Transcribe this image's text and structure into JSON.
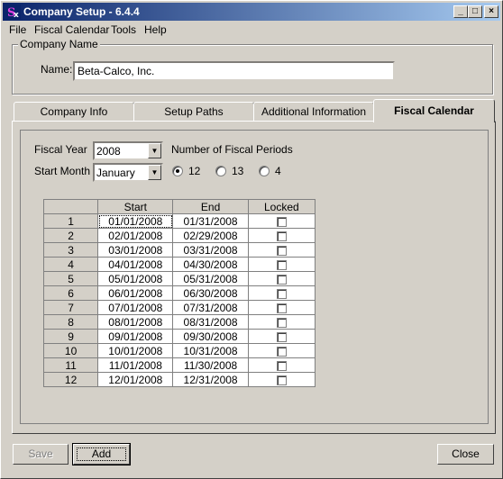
{
  "window": {
    "title": "Company Setup - 6.4.4",
    "controls": {
      "minimize": "_",
      "maximize": "□",
      "close": "×"
    }
  },
  "menu": [
    {
      "label": "File"
    },
    {
      "label": "Fiscal Calendar"
    },
    {
      "label": "Tools"
    },
    {
      "label": "Help"
    }
  ],
  "company": {
    "group_title": "Company Name",
    "name_label": "Name:",
    "name_value": "Beta-Calco, Inc."
  },
  "tabs": [
    {
      "label": "Company Info"
    },
    {
      "label": "Setup Paths"
    },
    {
      "label": "Additional Information"
    },
    {
      "label": "Fiscal Calendar"
    }
  ],
  "fiscal": {
    "year_label": "Fiscal Year",
    "year_value": "2008",
    "month_label": "Start Month",
    "month_value": "January",
    "periods_label": "Number of Fiscal Periods",
    "period_options": [
      "12",
      "13",
      "4"
    ],
    "period_selected": "12"
  },
  "grid": {
    "headers": [
      "",
      "Start",
      "End",
      "Locked"
    ],
    "rows": [
      {
        "num": "1",
        "start": "01/01/2008",
        "end": "01/31/2008",
        "locked": false
      },
      {
        "num": "2",
        "start": "02/01/2008",
        "end": "02/29/2008",
        "locked": false
      },
      {
        "num": "3",
        "start": "03/01/2008",
        "end": "03/31/2008",
        "locked": false
      },
      {
        "num": "4",
        "start": "04/01/2008",
        "end": "04/30/2008",
        "locked": false
      },
      {
        "num": "5",
        "start": "05/01/2008",
        "end": "05/31/2008",
        "locked": false
      },
      {
        "num": "6",
        "start": "06/01/2008",
        "end": "06/30/2008",
        "locked": false
      },
      {
        "num": "7",
        "start": "07/01/2008",
        "end": "07/31/2008",
        "locked": false
      },
      {
        "num": "8",
        "start": "08/01/2008",
        "end": "08/31/2008",
        "locked": false
      },
      {
        "num": "9",
        "start": "09/01/2008",
        "end": "09/30/2008",
        "locked": false
      },
      {
        "num": "10",
        "start": "10/01/2008",
        "end": "10/31/2008",
        "locked": false
      },
      {
        "num": "11",
        "start": "11/01/2008",
        "end": "11/30/2008",
        "locked": false
      },
      {
        "num": "12",
        "start": "12/01/2008",
        "end": "12/31/2008",
        "locked": false
      }
    ]
  },
  "buttons": {
    "save": "Save",
    "add": "Add",
    "close": "Close"
  },
  "colors": {
    "title_start": "#0a246a",
    "title_end": "#a6caf0",
    "face": "#d4d0c8"
  }
}
